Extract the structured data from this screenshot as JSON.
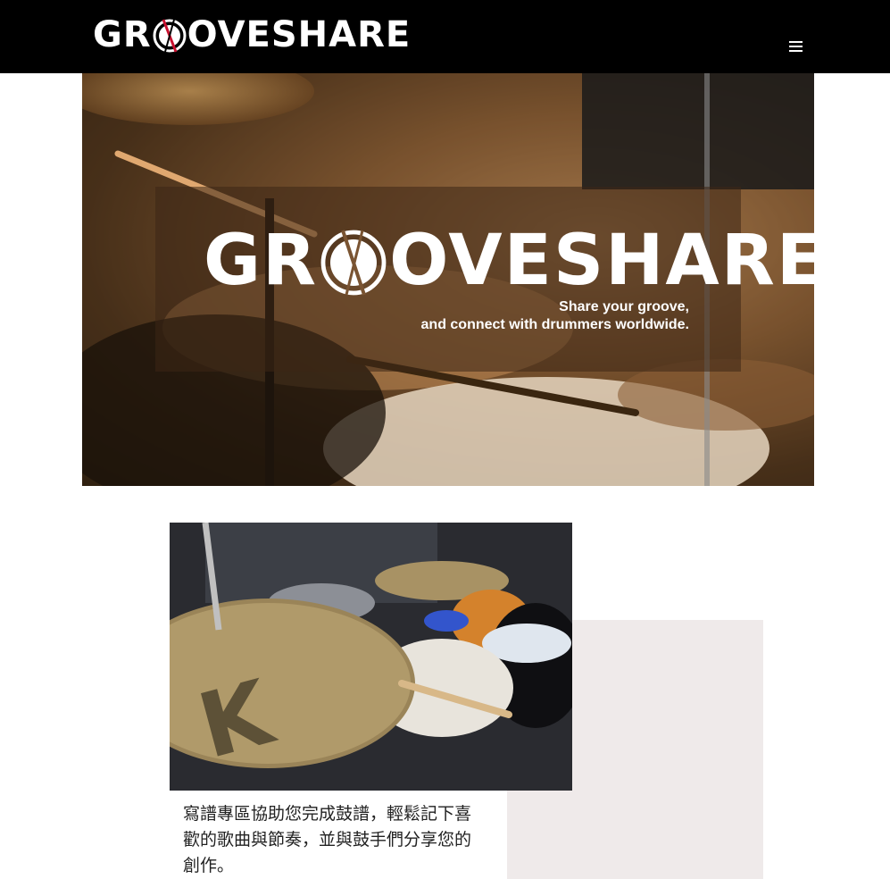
{
  "header": {
    "logo_left": "GR",
    "logo_right": "OVESHARE",
    "menu_icon": "hamburger-menu-icon"
  },
  "hero": {
    "logo_left": "GR",
    "logo_right": "OVESHARE",
    "tagline_line1": "Share your groove,",
    "tagline_line2": "and connect with drummers worldwide."
  },
  "feature": {
    "description": "寫譜專區協助您完成鼓譜，輕鬆記下喜歡的歌曲與節奏，並與鼓手們分享您的創作。"
  },
  "colors": {
    "nav_bg": "#000000",
    "panel_bg": "#efeaea",
    "logo_accent": "#c8102e"
  }
}
